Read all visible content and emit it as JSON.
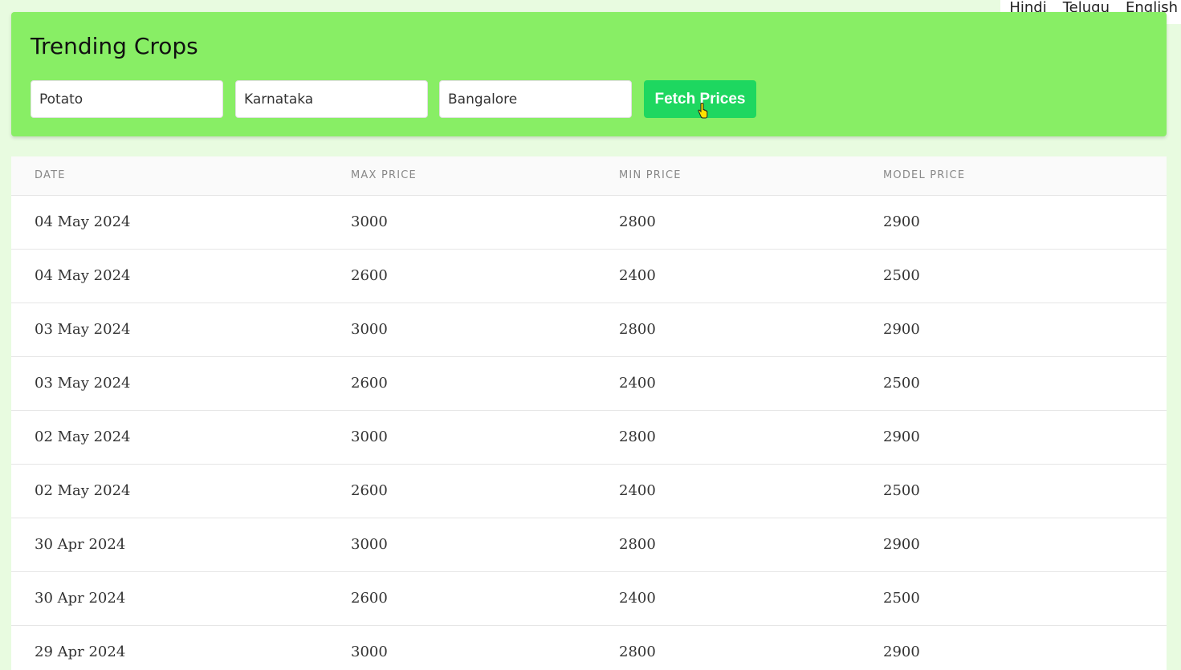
{
  "languages": [
    "Hindi",
    "Telugu",
    "English"
  ],
  "header": {
    "title": "Trending Crops",
    "crop_value": "Potato",
    "state_value": "Karnataka",
    "market_value": "Bangalore",
    "fetch_label": "Fetch Prices"
  },
  "table": {
    "columns": [
      "DATE",
      "MAX PRICE",
      "MIN PRICE",
      "MODEL PRICE"
    ],
    "rows": [
      [
        "04 May 2024",
        "3000",
        "2800",
        "2900"
      ],
      [
        "04 May 2024",
        "2600",
        "2400",
        "2500"
      ],
      [
        "03 May 2024",
        "3000",
        "2800",
        "2900"
      ],
      [
        "03 May 2024",
        "2600",
        "2400",
        "2500"
      ],
      [
        "02 May 2024",
        "3000",
        "2800",
        "2900"
      ],
      [
        "02 May 2024",
        "2600",
        "2400",
        "2500"
      ],
      [
        "30 Apr 2024",
        "3000",
        "2800",
        "2900"
      ],
      [
        "30 Apr 2024",
        "2600",
        "2400",
        "2500"
      ],
      [
        "29 Apr 2024",
        "3000",
        "2800",
        "2900"
      ]
    ]
  },
  "colors": {
    "page_bg": "#e8fbe0",
    "header_bg": "#88ee65",
    "button_bg": "#1ed760"
  }
}
